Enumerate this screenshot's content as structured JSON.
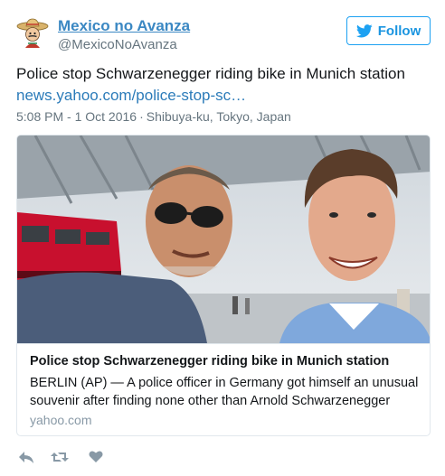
{
  "user": {
    "name": "Mexico no Avanza",
    "handle": "@MexicoNoAvanza",
    "avatar_icon": "sombrero-cartoon-avatar-icon"
  },
  "follow_button": {
    "label": "Follow",
    "icon": "twitter-bird-icon"
  },
  "tweet": {
    "text": "Police stop Schwarzenegger riding bike in Munich station",
    "link": "news.yahoo.com/police-stop-sc…",
    "time": "5:08 PM - 1 Oct 2016",
    "separator": "·",
    "location": "Shibuya-ku, Tokyo, Japan"
  },
  "card": {
    "image_icon": "selfie-photo-image",
    "title": "Police stop Schwarzenegger riding bike in Munich station",
    "description": "BERLIN (AP) — A police officer in Germany got himself an unusual souvenir after finding none other than Arnold Schwarzenegger",
    "domain": "yahoo.com"
  },
  "actions": [
    {
      "name": "reply",
      "icon": "reply-icon"
    },
    {
      "name": "retweet",
      "icon": "retweet-icon"
    },
    {
      "name": "like",
      "icon": "heart-icon"
    }
  ],
  "colors": {
    "link": "#2b7bb9",
    "name": "#3b88c3",
    "follow_border": "#1da1f2",
    "muted": "#66757f",
    "action_icon": "#8899a6"
  }
}
